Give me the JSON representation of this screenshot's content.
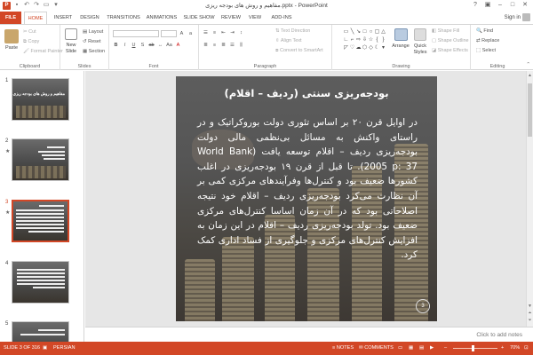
{
  "window": {
    "title": "مفاهیم و روش های بودجه ریزی.pptx - PowerPoint",
    "app_icon": "P",
    "accent": "#d24726"
  },
  "tabs": [
    "FILE",
    "HOME",
    "INSERT",
    "DESIGN",
    "TRANSITIONS",
    "ANIMATIONS",
    "SLIDE SHOW",
    "REVIEW",
    "VIEW",
    "ADD-INS"
  ],
  "signin": "Sign in",
  "ribbon": {
    "clipboard": {
      "label": "Clipboard",
      "paste": "Paste",
      "cut": "Cut",
      "copy": "Copy",
      "format_painter": "Format Painter"
    },
    "slides": {
      "label": "Slides",
      "new_slide": "New Slide",
      "layout": "Layout",
      "reset": "Reset",
      "section": "Section"
    },
    "font": {
      "label": "Font"
    },
    "paragraph": {
      "label": "Paragraph",
      "text_direction": "Text Direction",
      "align_text": "Align Text",
      "convert_smartart": "Convert to SmartArt"
    },
    "drawing": {
      "label": "Drawing",
      "arrange": "Arrange",
      "quick_styles": "Quick Styles",
      "shape_fill": "Shape Fill",
      "shape_outline": "Shape Outline",
      "shape_effects": "Shape Effects"
    },
    "editing": {
      "label": "Editing",
      "find": "Find",
      "replace": "Replace",
      "select": "Select"
    }
  },
  "thumbnails": [
    {
      "num": "1",
      "title": "مفاهیم و روش های بودجه ریزی"
    },
    {
      "num": "2"
    },
    {
      "num": "3",
      "selected": true
    },
    {
      "num": "4"
    },
    {
      "num": "5"
    }
  ],
  "slide": {
    "title": "بودجه‌ریزی سنتی (ردیف – اقلام)",
    "body": "در اوایل قرن ۲۰ بر اساس تئوری دولت بوروکراتیک و در راستای واکنش به مسائل بی‌نظمی مالی دولت بودجه‌ریزی ردیف – اقلام توسعه یافت (World Bank 2005 p: 37). تا قبل از قرن ۱۹ بودجه‌ریزی در اغلب کشورها ضعیف بود و کنترل‌ها وفرآیندهای مرکزی کمی بر آن نظارت می‌کرد بودجه‌ریزی ردیف – اقلام خود نتیجه اصلاحاتی بود که در آن زمان اساسا کنترل‌های مرکزی ضعیف بود. تولد بودجه‌ریزی ردیف – اقلام در این زمان به افزایش کنترل‌های مرکزی و جلوگیری از فساد اداری کمک کرد.",
    "number": "3"
  },
  "notes_placeholder": "Click to add notes",
  "status": {
    "slide_of": "SLIDE 3 OF 316",
    "language": "PERSIAN",
    "notes": "NOTES",
    "comments": "COMMENTS",
    "zoom": "70%"
  }
}
